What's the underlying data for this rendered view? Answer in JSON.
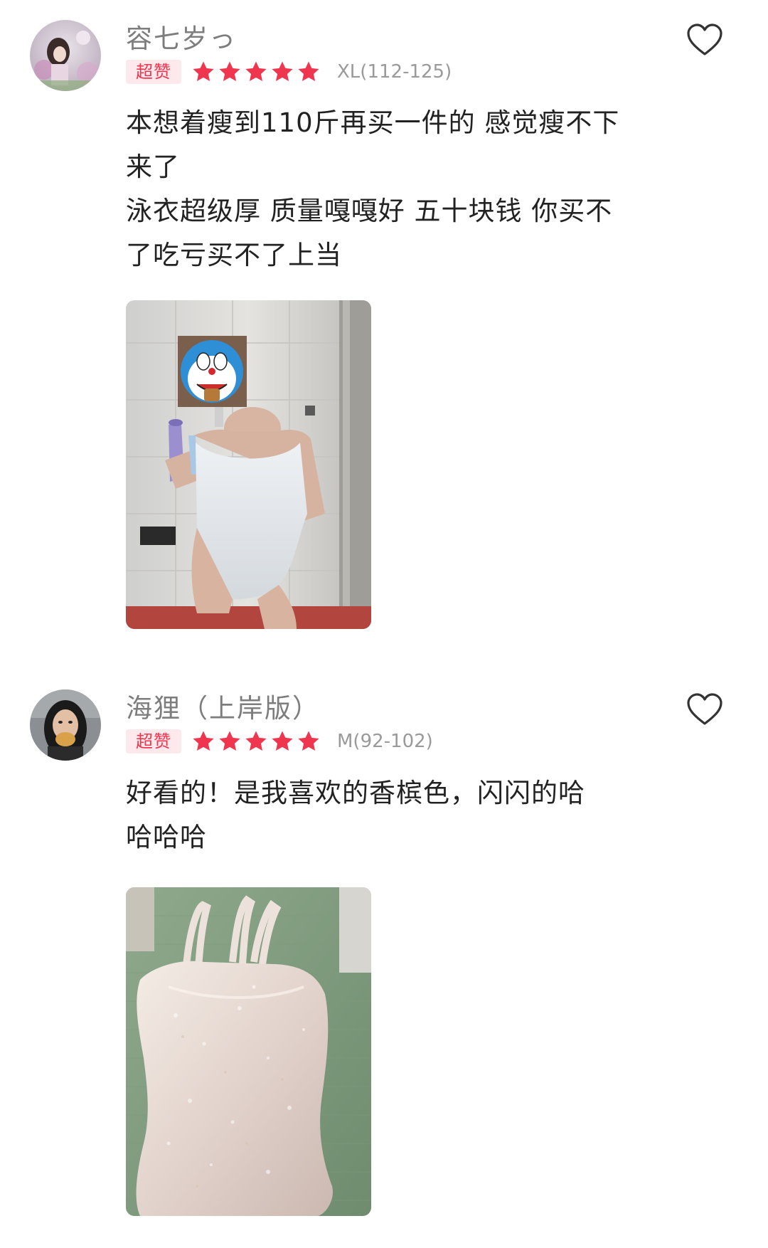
{
  "reviews": [
    {
      "username": "容七岁っ",
      "badge": "超赞",
      "rating": 5,
      "size": "XL(112-125)",
      "lines": [
        "本想着瘦到110斤再买一件的 感觉瘦不下",
        "来了",
        "泳衣超级厚 质量嘎嘎好 五十块钱 你买不",
        "了吃亏买不了上当"
      ],
      "icons": {
        "avatar": "avatar-photo",
        "like": "heart-outline-icon",
        "star": "star-icon"
      },
      "photo": "swimsuit-mirror-selfie-photo"
    },
    {
      "username": "海狸（上岸版）",
      "badge": "超赞",
      "rating": 5,
      "size": "M(92-102)",
      "lines": [
        "好看的！是我喜欢的香槟色，闪闪的哈",
        "哈哈哈"
      ],
      "icons": {
        "avatar": "avatar-photo",
        "like": "heart-outline-icon",
        "star": "star-icon"
      },
      "photo": "swimsuit-flat-lay-photo"
    }
  ],
  "colors": {
    "badge_text": "#f0364f",
    "badge_bg": "#fde8ec",
    "star": "#f0364f",
    "username": "#7d7d7d",
    "meta": "#9a9a9a"
  }
}
